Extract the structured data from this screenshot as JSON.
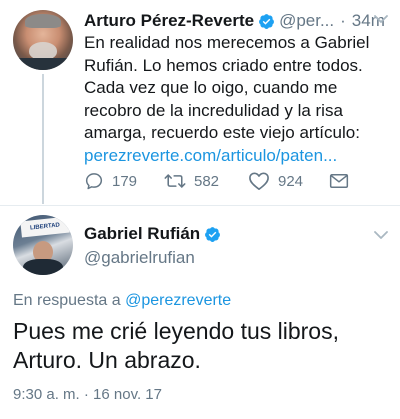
{
  "tweet1": {
    "author_name": "Arturo Pérez-Reverte",
    "handle": "@per...",
    "separator": "·",
    "time": "34m",
    "text_lines": [
      "En realidad nos merecemos a Gabriel",
      "Rufián. Lo hemos criado entre todos.",
      "Cada vez que lo oigo, cuando me",
      "recobro de la incredulidad y la risa",
      "amarga, recuerdo este viejo artículo:"
    ],
    "link": "perezreverte.com/articulo/paten...",
    "replies": "179",
    "retweets": "582",
    "likes": "924",
    "icons": [
      "reply-icon",
      "retweet-icon",
      "like-icon",
      "message-icon",
      "verified-icon",
      "chevron-down-icon"
    ]
  },
  "tweet2": {
    "author_name": "Gabriel Rufián",
    "handle": "@gabrielrufian",
    "avatar_sign_text": "LIBERTAD",
    "reply_prefix": "En respuesta a",
    "reply_mention": "@perezreverte",
    "text_lines": [
      "Pues me crié leyendo tus libros,",
      "Arturo. Un abrazo."
    ],
    "timestamp": "9:30 a. m. · 16 nov. 17"
  },
  "colors": {
    "link": "#1b95e0",
    "secondary_text": "#657786",
    "primary_text": "#14171a",
    "verified": "#1da1f2"
  }
}
